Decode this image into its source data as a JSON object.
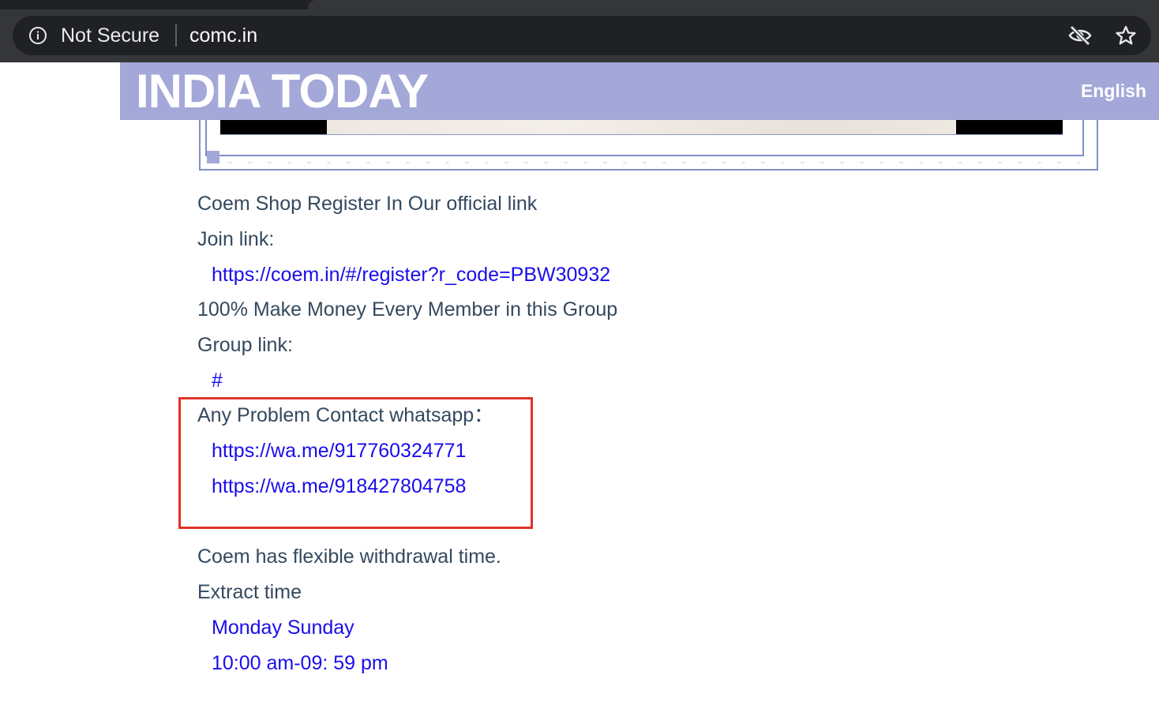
{
  "browser": {
    "security_label": "Not Secure",
    "url": "comc.in"
  },
  "banner": {
    "title": "INDIA TODAY",
    "language": "English"
  },
  "content": {
    "register_heading": "Coem Shop Register In Our official link",
    "join_label": "Join link:",
    "join_url": "https://coem.in/#/register?r_code=PBW30932",
    "make_money": "100% Make Money Every Member in this Group",
    "group_label": "Group link:",
    "group_url": "#",
    "contact_label": "Any Problem Contact whatsapp：",
    "whatsapp_1": "https://wa.me/917760324771",
    "whatsapp_2": "https://wa.me/918427804758",
    "withdrawal": "Coem has flexible withdrawal time.",
    "extract_label": "Extract time",
    "extract_days": "Monday Sunday",
    "extract_hours": "10:00 am-09: 59 pm"
  },
  "colors": {
    "banner_bg": "#a3a8d8",
    "text": "#34495e",
    "link": "#1a0dea",
    "highlight": "#e0332b"
  }
}
